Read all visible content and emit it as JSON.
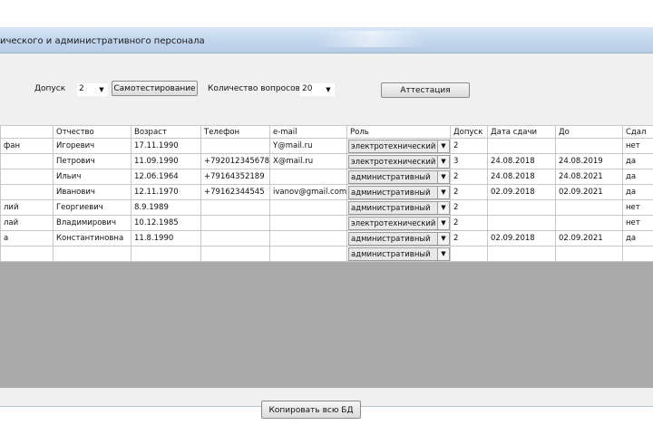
{
  "window": {
    "title": "ического и административного персонала"
  },
  "toolbar": {
    "dopusk_label": "Допуск",
    "dopusk_value": "2",
    "self_test_button": "Самотестирование",
    "questions_label": "Количество вопросов",
    "questions_value": "20",
    "attestation_button": "Аттестация"
  },
  "grid": {
    "columns": [
      "",
      "Отчество",
      "Возраст",
      "Телефон",
      "e-mail",
      "Роль",
      "Допуск",
      "Дата сдачи",
      "До",
      "Сдал"
    ],
    "rows": [
      [
        "фан",
        "Игоревич",
        "17.11.1990",
        "",
        "Y@mail.ru",
        "электротехнический",
        "2",
        "",
        "",
        "нет"
      ],
      [
        "",
        "Петрович",
        "11.09.1990",
        "+792012345678",
        "X@mail.ru",
        "электротехнический",
        "3",
        "24.08.2018",
        "24.08.2019",
        "да"
      ],
      [
        "",
        "Ильич",
        "12.06.1964",
        "+79164352189",
        "",
        "административный",
        "2",
        "24.08.2018",
        "24.08.2021",
        "да"
      ],
      [
        "",
        "Иванович",
        "12.11.1970",
        "+79162344545",
        "ivanov@gmail.com",
        "административный",
        "2",
        "02.09.2018",
        "02.09.2021",
        "да"
      ],
      [
        "лий",
        "Георгиевич",
        "8.9.1989",
        "",
        "",
        "административный",
        "2",
        "",
        "",
        "нет"
      ],
      [
        "лай",
        "Владимирович",
        "10.12.1985",
        "",
        "",
        "электротехнический",
        "2",
        "",
        "",
        "нет"
      ],
      [
        "а",
        "Константиновна",
        "11.8.1990",
        "",
        "",
        "административный",
        "2",
        "02.09.2018",
        "02.09.2021",
        "да"
      ],
      [
        "",
        "",
        "",
        "",
        "",
        "административный",
        "",
        "",
        "",
        ""
      ]
    ]
  },
  "footer": {
    "copy_button": "Копировать всю БД"
  },
  "icons": {
    "dropdown": "chevron-down-icon"
  }
}
